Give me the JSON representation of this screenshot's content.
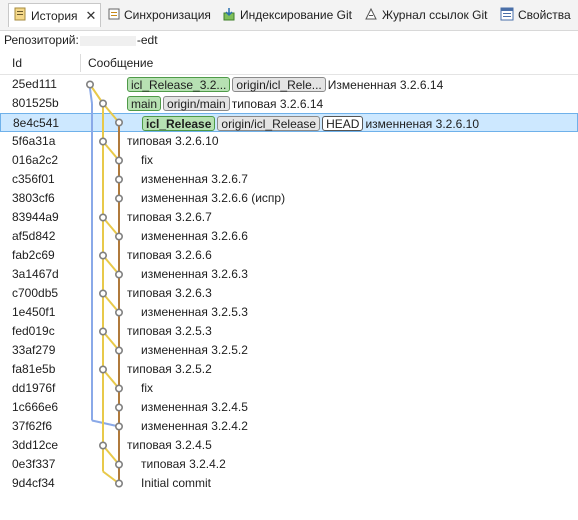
{
  "tabs": [
    {
      "label": "История",
      "icon": "history-icon",
      "active": true
    },
    {
      "label": "Синхронизация",
      "icon": "sync-icon",
      "active": false
    },
    {
      "label": "Индексирование Git",
      "icon": "git-staging-icon",
      "active": false
    },
    {
      "label": "Журнал ссылок Git",
      "icon": "reflog-icon",
      "active": false
    },
    {
      "label": "Свойства",
      "icon": "properties-icon",
      "active": false
    }
  ],
  "repository": {
    "label": "Репозиторий:",
    "name_suffix": "-edt"
  },
  "columns": {
    "id": "Id",
    "message": "Сообщение"
  },
  "colors": {
    "blue_lane": "#8aa9e8",
    "yellow_lane": "#e8c94a",
    "brown_lane": "#b07a3c",
    "node": "#808080",
    "selection": "#cde8ff"
  },
  "commits": [
    {
      "id": "25ed111",
      "refs": [
        {
          "label": "icl_Release_3.2...",
          "kind": "local"
        },
        {
          "label": "origin/icl_Rele...",
          "kind": "remote"
        }
      ],
      "message": "Измененная 3.2.6.14"
    },
    {
      "id": "801525b",
      "refs": [
        {
          "label": "main",
          "kind": "local"
        },
        {
          "label": "origin/main",
          "kind": "remote"
        }
      ],
      "message": "типовая 3.2.6.14"
    },
    {
      "id": "8e4c541",
      "refs": [
        {
          "label": "icl_Release",
          "kind": "local",
          "bold": true
        },
        {
          "label": "origin/icl_Release",
          "kind": "remote"
        },
        {
          "label": "HEAD",
          "kind": "head"
        }
      ],
      "message": "изменненая 3.2.6.10",
      "selected": true
    },
    {
      "id": "5f6a31a",
      "refs": [],
      "message": "типовая 3.2.6.10"
    },
    {
      "id": "016a2c2",
      "refs": [],
      "message": "fix"
    },
    {
      "id": "c356f01",
      "refs": [],
      "message": "измененная 3.2.6.7"
    },
    {
      "id": "3803cf6",
      "refs": [],
      "message": "измененная 3.2.6.6 (испр)"
    },
    {
      "id": "83944a9",
      "refs": [],
      "message": "типовая 3.2.6.7"
    },
    {
      "id": "af5d842",
      "refs": [],
      "message": "измененная 3.2.6.6"
    },
    {
      "id": "fab2c69",
      "refs": [],
      "message": "типовая 3.2.6.6"
    },
    {
      "id": "3a1467d",
      "refs": [],
      "message": "измененная 3.2.6.3"
    },
    {
      "id": "c700db5",
      "refs": [],
      "message": "типовая 3.2.6.3"
    },
    {
      "id": "1e450f1",
      "refs": [],
      "message": "измененная 3.2.5.3"
    },
    {
      "id": "fed019c",
      "refs": [],
      "message": "типовая 3.2.5.3"
    },
    {
      "id": "33af279",
      "refs": [],
      "message": "измененная 3.2.5.2"
    },
    {
      "id": "fa81e5b",
      "refs": [],
      "message": "типовая 3.2.5.2"
    },
    {
      "id": "dd1976f",
      "refs": [],
      "message": "fix"
    },
    {
      "id": "1c666e6",
      "refs": [],
      "message": "измененная 3.2.4.5"
    },
    {
      "id": "37f62f6",
      "refs": [],
      "message": "измененная 3.2.4.2"
    },
    {
      "id": "3dd12ce",
      "refs": [],
      "message": "типовая 3.2.4.5"
    },
    {
      "id": "0e3f337",
      "refs": [],
      "message": "типовая 3.2.4.2"
    },
    {
      "id": "9d4cf34",
      "refs": [],
      "message": "Initial commit"
    }
  ],
  "graph_lanes": [
    1,
    2,
    3,
    2,
    3,
    3,
    3,
    2,
    3,
    2,
    3,
    2,
    3,
    2,
    3,
    2,
    3,
    3,
    3,
    2,
    3,
    3
  ]
}
